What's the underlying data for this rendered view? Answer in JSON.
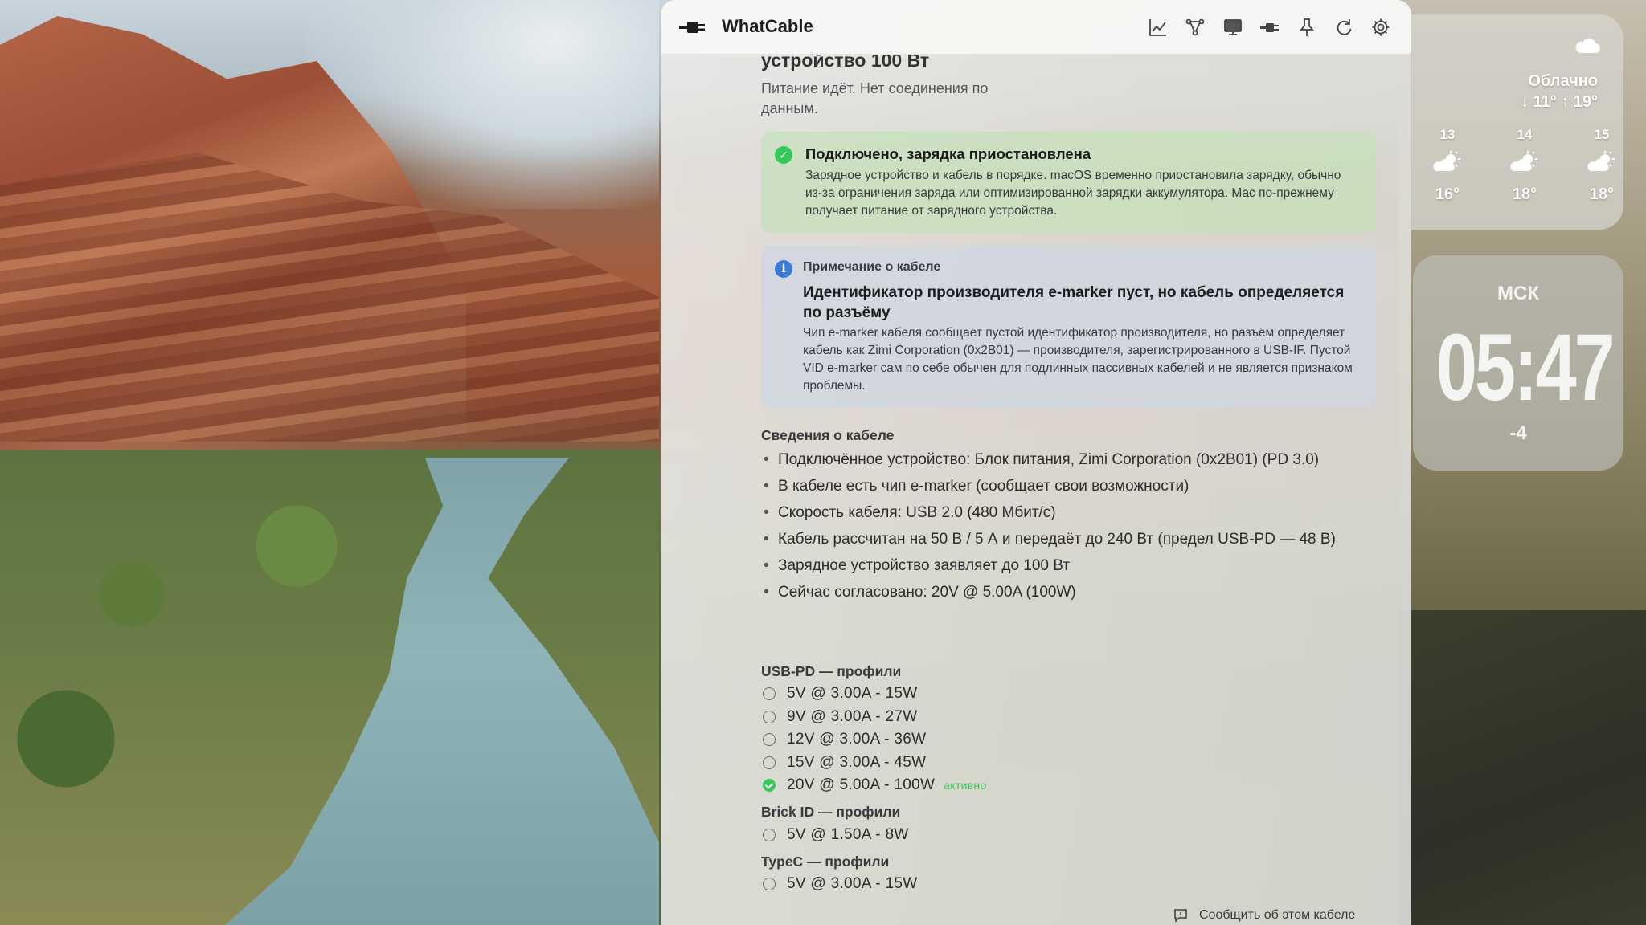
{
  "app": {
    "title": "WhatCable"
  },
  "toolbar": {
    "icons": [
      "chart-icon",
      "topology-icon",
      "display-icon",
      "cable-icon",
      "pin-icon",
      "refresh-icon",
      "settings-icon"
    ]
  },
  "header": {
    "title": "устройство 100 Вт",
    "lead": "Питание идёт. Нет соединения по данным."
  },
  "status_card": {
    "title": "Подключено, зарядка приостановлена",
    "body": "Зарядное устройство и кабель в порядке. macOS временно приостановила зарядку, обычно из-за ограничения заряда или оптимизированной зарядки аккумулятора. Мас по-прежнему получает питание от зарядного устройства.",
    "color": "#34c759"
  },
  "note_card": {
    "kicker": "Примечание о кабеле",
    "title": "Идентификатор производителя e-marker пуст, но кабель определяется по разъёму",
    "body": "Чип e-marker кабеля сообщает пустой идентификатор производителя, но разъём определяет кабель как Zimi Corporation (0x2B01) — производителя, зарегистрированного в USB-IF. Пустой VID e-marker сам по себе обычен для подлинных пассивных кабелей и не является признаком проблемы.",
    "color": "#3a7bd5"
  },
  "cable_info": {
    "heading": "Сведения о кабеле",
    "items": [
      "Подключённое устройство: Блок питания, Zimi Corporation (0x2B01) (PD 3.0)",
      "В кабеле есть чип e-marker (сообщает свои возможности)",
      "Скорость кабеля: USB 2.0 (480 Мбит/с)",
      "Кабель рассчитан на 50 В / 5 А и передаёт до 240 Вт (предел USB-PD — 48 В)",
      "Зарядное устройство заявляет до 100 Вт",
      "Сейчас согласовано: 20V @ 5.00A (100W)"
    ]
  },
  "usbpd": {
    "heading": "USB-PD — профили",
    "profiles": [
      {
        "label": "5V @ 3.00A - 15W",
        "active": false
      },
      {
        "label": "9V @ 3.00A - 27W",
        "active": false
      },
      {
        "label": "12V @ 3.00A - 36W",
        "active": false
      },
      {
        "label": "15V @ 3.00A - 45W",
        "active": false
      },
      {
        "label": "20V @ 5.00A - 100W",
        "active": true,
        "tag": "активно"
      }
    ]
  },
  "brickid": {
    "heading": "Brick ID — профили",
    "profiles": [
      {
        "label": "5V @ 1.50A - 8W",
        "active": false
      }
    ]
  },
  "typec": {
    "heading": "TypeC — профили",
    "profiles": [
      {
        "label": "5V @ 3.00A - 15W",
        "active": false
      }
    ]
  },
  "footer": {
    "report_label": "Сообщить об этом кабеле"
  },
  "weather": {
    "condition": "Облачно",
    "range": "↓ 11° ↑ 19°",
    "forecast": [
      {
        "day": "13",
        "temp": "16°",
        "icon": "partly-sunny-icon"
      },
      {
        "day": "14",
        "temp": "18°",
        "icon": "partly-sunny-icon"
      },
      {
        "day": "15",
        "temp": "18°",
        "icon": "partly-sunny-icon"
      }
    ]
  },
  "clock": {
    "city": "МСК",
    "time": "05:47",
    "offset": "-4"
  }
}
